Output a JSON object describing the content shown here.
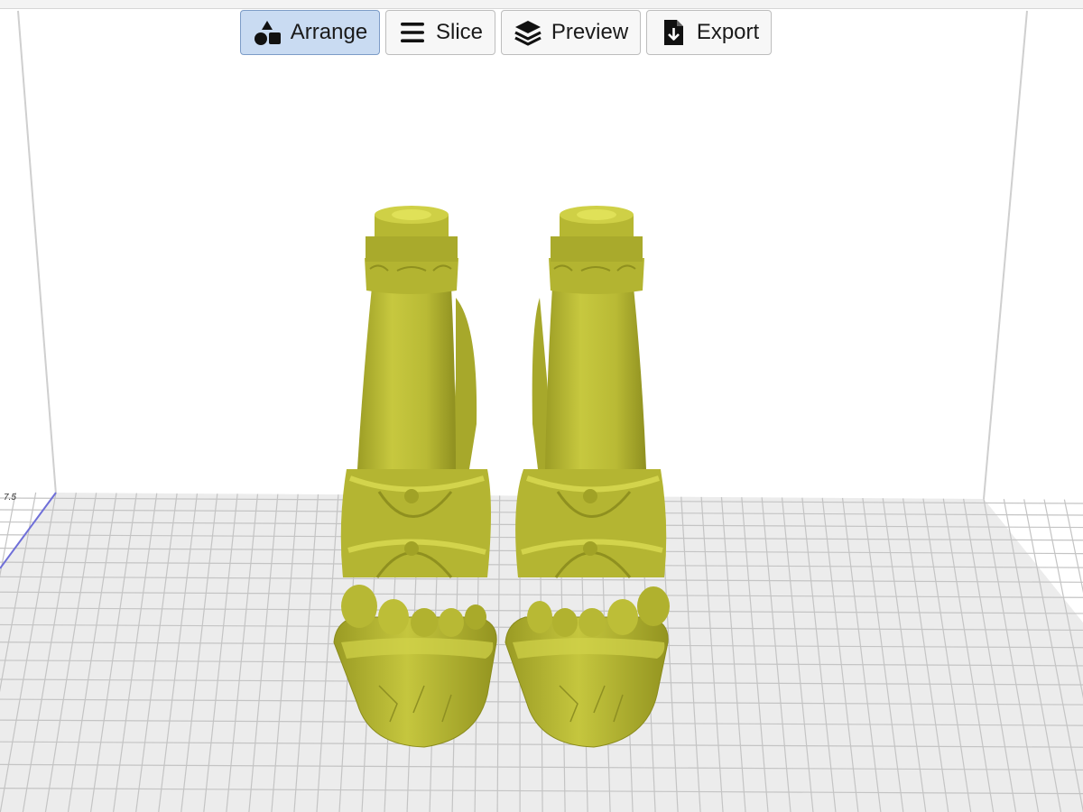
{
  "toolbar": {
    "arrange_label": "Arrange",
    "slice_label": "Slice",
    "preview_label": "Preview",
    "export_label": "Export",
    "active_tool": "Arrange"
  },
  "viewport": {
    "axis_tick_label": "7.5",
    "model_color": "#bfc03a",
    "grid_color": "#c4c4c4",
    "plate_color": "#ececec",
    "active_button_color": "#c9dbf2"
  },
  "icons": {
    "arrange": "shapes-icon",
    "slice": "hamburger-lines-icon",
    "preview": "layers-stack-icon",
    "export": "file-download-icon"
  }
}
